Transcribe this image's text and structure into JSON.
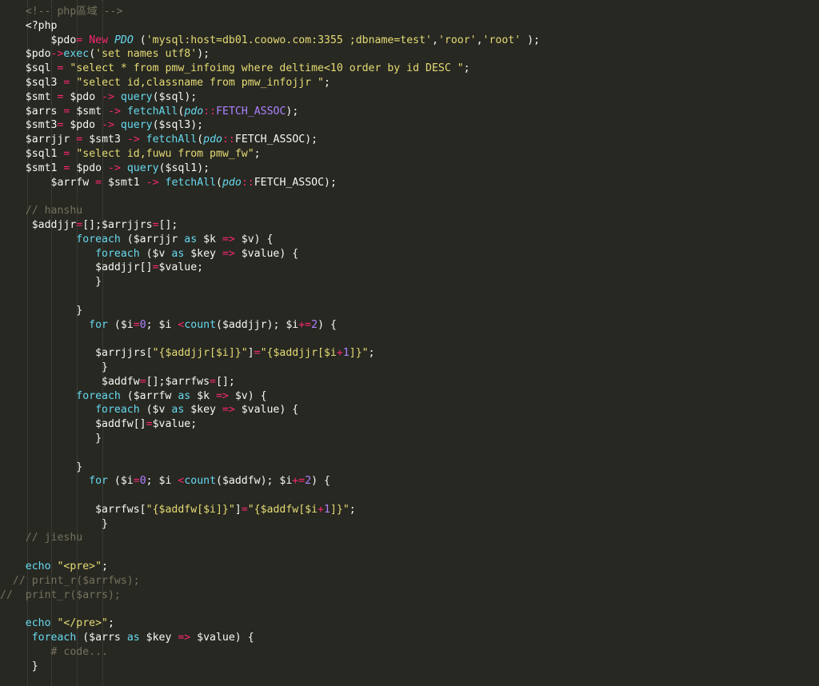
{
  "editor": {
    "theme_colors": {
      "background": "#272822",
      "text": "#f8f8f2",
      "keyword": "#66d9ef",
      "operator": "#f92672",
      "string": "#e6db74",
      "comment": "#75715e",
      "constant": "#ae81ff"
    },
    "lines": [
      {
        "indent": "    ",
        "tokens": [
          {
            "t": "cmt",
            "v": "<!-- php區域 -->"
          }
        ]
      },
      {
        "indent": "    ",
        "tokens": [
          {
            "t": "text",
            "v": "<?php"
          }
        ]
      },
      {
        "indent": "        ",
        "tokens": [
          {
            "t": "var",
            "v": "$pdo"
          },
          {
            "t": "op",
            "v": "="
          },
          {
            "t": "text",
            "v": " "
          },
          {
            "t": "kwr",
            "v": "New"
          },
          {
            "t": "text",
            "v": " "
          },
          {
            "t": "cls",
            "v": "PDO"
          },
          {
            "t": "text",
            "v": " ("
          },
          {
            "t": "str",
            "v": "'mysql:host=db01.coowo.com:3355 ;dbname=test'"
          },
          {
            "t": "text",
            "v": ","
          },
          {
            "t": "str",
            "v": "'roor'"
          },
          {
            "t": "text",
            "v": ","
          },
          {
            "t": "str",
            "v": "'root'"
          },
          {
            "t": "text",
            "v": " );"
          }
        ]
      },
      {
        "indent": "    ",
        "tokens": [
          {
            "t": "var",
            "v": "$pdo"
          },
          {
            "t": "op",
            "v": "->"
          },
          {
            "t": "fn",
            "v": "exec"
          },
          {
            "t": "text",
            "v": "("
          },
          {
            "t": "str",
            "v": "'set names utf8'"
          },
          {
            "t": "text",
            "v": ");"
          }
        ]
      },
      {
        "indent": "    ",
        "tokens": [
          {
            "t": "var",
            "v": "$sql"
          },
          {
            "t": "text",
            "v": " "
          },
          {
            "t": "op",
            "v": "="
          },
          {
            "t": "text",
            "v": " "
          },
          {
            "t": "str",
            "v": "\"select * from pmw_infoimg where deltime<10 order by id DESC \""
          },
          {
            "t": "text",
            "v": ";"
          }
        ]
      },
      {
        "indent": "    ",
        "tokens": [
          {
            "t": "var",
            "v": "$sql3"
          },
          {
            "t": "text",
            "v": " "
          },
          {
            "t": "op",
            "v": "="
          },
          {
            "t": "text",
            "v": " "
          },
          {
            "t": "str",
            "v": "\"select id,classname from pmw_infojjr \""
          },
          {
            "t": "text",
            "v": ";"
          }
        ]
      },
      {
        "indent": "    ",
        "tokens": [
          {
            "t": "var",
            "v": "$smt"
          },
          {
            "t": "text",
            "v": " "
          },
          {
            "t": "op",
            "v": "="
          },
          {
            "t": "text",
            "v": " $pdo "
          },
          {
            "t": "op",
            "v": "->"
          },
          {
            "t": "text",
            "v": " "
          },
          {
            "t": "fn",
            "v": "query"
          },
          {
            "t": "text",
            "v": "($sql);"
          }
        ]
      },
      {
        "indent": "    ",
        "tokens": [
          {
            "t": "var",
            "v": "$arrs"
          },
          {
            "t": "text",
            "v": " "
          },
          {
            "t": "op",
            "v": "="
          },
          {
            "t": "text",
            "v": " $smt "
          },
          {
            "t": "op",
            "v": "->"
          },
          {
            "t": "text",
            "v": " "
          },
          {
            "t": "fn",
            "v": "fetchAll"
          },
          {
            "t": "text",
            "v": "("
          },
          {
            "t": "cls",
            "v": "pdo"
          },
          {
            "t": "op",
            "v": "::"
          },
          {
            "t": "const",
            "v": "FETCH_ASSOC"
          },
          {
            "t": "text",
            "v": ");"
          }
        ]
      },
      {
        "indent": "    ",
        "tokens": [
          {
            "t": "var",
            "v": "$smt3"
          },
          {
            "t": "op",
            "v": "="
          },
          {
            "t": "text",
            "v": " $pdo "
          },
          {
            "t": "op",
            "v": "->"
          },
          {
            "t": "text",
            "v": " "
          },
          {
            "t": "fn",
            "v": "query"
          },
          {
            "t": "text",
            "v": "($sql3);"
          }
        ]
      },
      {
        "indent": "    ",
        "tokens": [
          {
            "t": "var",
            "v": "$arrjjr"
          },
          {
            "t": "text",
            "v": " "
          },
          {
            "t": "op",
            "v": "="
          },
          {
            "t": "text",
            "v": " $smt3 "
          },
          {
            "t": "op",
            "v": "->"
          },
          {
            "t": "text",
            "v": " "
          },
          {
            "t": "fn",
            "v": "fetchAll"
          },
          {
            "t": "text",
            "v": "("
          },
          {
            "t": "cls",
            "v": "pdo"
          },
          {
            "t": "op",
            "v": "::"
          },
          {
            "t": "text",
            "v": "FETCH_ASSOC);"
          }
        ]
      },
      {
        "indent": "    ",
        "tokens": [
          {
            "t": "var",
            "v": "$sql1"
          },
          {
            "t": "text",
            "v": " "
          },
          {
            "t": "op",
            "v": "="
          },
          {
            "t": "text",
            "v": " "
          },
          {
            "t": "str",
            "v": "\"select id,fuwu from pmw_fw\""
          },
          {
            "t": "text",
            "v": ";"
          }
        ]
      },
      {
        "indent": "    ",
        "tokens": [
          {
            "t": "var",
            "v": "$smt1"
          },
          {
            "t": "text",
            "v": " "
          },
          {
            "t": "op",
            "v": "="
          },
          {
            "t": "text",
            "v": " $pdo "
          },
          {
            "t": "op",
            "v": "->"
          },
          {
            "t": "text",
            "v": " "
          },
          {
            "t": "fn",
            "v": "query"
          },
          {
            "t": "text",
            "v": "($sql1);"
          }
        ]
      },
      {
        "indent": "        ",
        "tokens": [
          {
            "t": "var",
            "v": "$arrfw"
          },
          {
            "t": "text",
            "v": " "
          },
          {
            "t": "op",
            "v": "="
          },
          {
            "t": "text",
            "v": " $smt1 "
          },
          {
            "t": "op",
            "v": "->"
          },
          {
            "t": "text",
            "v": " "
          },
          {
            "t": "fn",
            "v": "fetchAll"
          },
          {
            "t": "text",
            "v": "("
          },
          {
            "t": "cls",
            "v": "pdo"
          },
          {
            "t": "op",
            "v": "::"
          },
          {
            "t": "text",
            "v": "FETCH_ASSOC);"
          }
        ]
      },
      {
        "indent": "",
        "tokens": []
      },
      {
        "indent": "    ",
        "tokens": [
          {
            "t": "cmt",
            "v": "// hanshu"
          }
        ]
      },
      {
        "indent": "     ",
        "tokens": [
          {
            "t": "var",
            "v": "$addjjr"
          },
          {
            "t": "op",
            "v": "="
          },
          {
            "t": "text",
            "v": "[];$arrjjrs"
          },
          {
            "t": "op",
            "v": "="
          },
          {
            "t": "text",
            "v": "[];"
          }
        ]
      },
      {
        "indent": "            ",
        "tokens": [
          {
            "t": "kw",
            "v": "foreach"
          },
          {
            "t": "text",
            "v": " ($arrjjr "
          },
          {
            "t": "kw",
            "v": "as"
          },
          {
            "t": "text",
            "v": " $k "
          },
          {
            "t": "op",
            "v": "=>"
          },
          {
            "t": "text",
            "v": " $v) {"
          }
        ]
      },
      {
        "indent": "               ",
        "tokens": [
          {
            "t": "kw",
            "v": "foreach"
          },
          {
            "t": "text",
            "v": " ($v "
          },
          {
            "t": "kw",
            "v": "as"
          },
          {
            "t": "text",
            "v": " $key "
          },
          {
            "t": "op",
            "v": "=>"
          },
          {
            "t": "text",
            "v": " $value) {"
          }
        ]
      },
      {
        "indent": "               ",
        "tokens": [
          {
            "t": "var",
            "v": "$addjjr"
          },
          {
            "t": "text",
            "v": "[]"
          },
          {
            "t": "op",
            "v": "="
          },
          {
            "t": "text",
            "v": "$value;"
          }
        ]
      },
      {
        "indent": "               ",
        "tokens": [
          {
            "t": "text",
            "v": "}"
          }
        ]
      },
      {
        "indent": "",
        "tokens": []
      },
      {
        "indent": "            ",
        "tokens": [
          {
            "t": "text",
            "v": "}"
          }
        ]
      },
      {
        "indent": "              ",
        "tokens": [
          {
            "t": "kw",
            "v": "for"
          },
          {
            "t": "text",
            "v": " ($i"
          },
          {
            "t": "op",
            "v": "="
          },
          {
            "t": "num",
            "v": "0"
          },
          {
            "t": "text",
            "v": "; $i "
          },
          {
            "t": "op",
            "v": "<"
          },
          {
            "t": "fn",
            "v": "count"
          },
          {
            "t": "text",
            "v": "($addjjr); $i"
          },
          {
            "t": "op",
            "v": "+="
          },
          {
            "t": "num",
            "v": "2"
          },
          {
            "t": "text",
            "v": ") {"
          }
        ]
      },
      {
        "indent": "",
        "tokens": []
      },
      {
        "indent": "               ",
        "tokens": [
          {
            "t": "var",
            "v": "$arrjjrs"
          },
          {
            "t": "text",
            "v": "["
          },
          {
            "t": "str",
            "v": "\"{$addjjr[$i]}\""
          },
          {
            "t": "text",
            "v": "]"
          },
          {
            "t": "op",
            "v": "="
          },
          {
            "t": "str",
            "v": "\"{$addjjr[$i"
          },
          {
            "t": "op",
            "v": "+"
          },
          {
            "t": "num",
            "v": "1"
          },
          {
            "t": "str",
            "v": "]}\""
          },
          {
            "t": "text",
            "v": ";"
          }
        ]
      },
      {
        "indent": "                ",
        "tokens": [
          {
            "t": "text",
            "v": "}"
          }
        ]
      },
      {
        "indent": "                ",
        "tokens": [
          {
            "t": "var",
            "v": "$addfw"
          },
          {
            "t": "op",
            "v": "="
          },
          {
            "t": "text",
            "v": "[];$arrfws"
          },
          {
            "t": "op",
            "v": "="
          },
          {
            "t": "text",
            "v": "[];"
          }
        ]
      },
      {
        "indent": "            ",
        "tokens": [
          {
            "t": "kw",
            "v": "foreach"
          },
          {
            "t": "text",
            "v": " ($arrfw "
          },
          {
            "t": "kw",
            "v": "as"
          },
          {
            "t": "text",
            "v": " $k "
          },
          {
            "t": "op",
            "v": "=>"
          },
          {
            "t": "text",
            "v": " $v) {"
          }
        ]
      },
      {
        "indent": "               ",
        "tokens": [
          {
            "t": "kw",
            "v": "foreach"
          },
          {
            "t": "text",
            "v": " ($v "
          },
          {
            "t": "kw",
            "v": "as"
          },
          {
            "t": "text",
            "v": " $key "
          },
          {
            "t": "op",
            "v": "=>"
          },
          {
            "t": "text",
            "v": " $value) {"
          }
        ]
      },
      {
        "indent": "               ",
        "tokens": [
          {
            "t": "var",
            "v": "$addfw"
          },
          {
            "t": "text",
            "v": "[]"
          },
          {
            "t": "op",
            "v": "="
          },
          {
            "t": "text",
            "v": "$value;"
          }
        ]
      },
      {
        "indent": "               ",
        "tokens": [
          {
            "t": "text",
            "v": "}"
          }
        ]
      },
      {
        "indent": "",
        "tokens": []
      },
      {
        "indent": "            ",
        "tokens": [
          {
            "t": "text",
            "v": "}"
          }
        ]
      },
      {
        "indent": "              ",
        "tokens": [
          {
            "t": "kw",
            "v": "for"
          },
          {
            "t": "text",
            "v": " ($i"
          },
          {
            "t": "op",
            "v": "="
          },
          {
            "t": "num",
            "v": "0"
          },
          {
            "t": "text",
            "v": "; $i "
          },
          {
            "t": "op",
            "v": "<"
          },
          {
            "t": "fn",
            "v": "count"
          },
          {
            "t": "text",
            "v": "($addfw); $i"
          },
          {
            "t": "op",
            "v": "+="
          },
          {
            "t": "num",
            "v": "2"
          },
          {
            "t": "text",
            "v": ") {"
          }
        ]
      },
      {
        "indent": "",
        "tokens": []
      },
      {
        "indent": "               ",
        "tokens": [
          {
            "t": "var",
            "v": "$arrfws"
          },
          {
            "t": "text",
            "v": "["
          },
          {
            "t": "str",
            "v": "\"{$addfw[$i]}\""
          },
          {
            "t": "text",
            "v": "]"
          },
          {
            "t": "op",
            "v": "="
          },
          {
            "t": "str",
            "v": "\"{$addfw[$i"
          },
          {
            "t": "op",
            "v": "+"
          },
          {
            "t": "num",
            "v": "1"
          },
          {
            "t": "str",
            "v": "]}\""
          },
          {
            "t": "text",
            "v": ";"
          }
        ]
      },
      {
        "indent": "                ",
        "tokens": [
          {
            "t": "text",
            "v": "}"
          }
        ]
      },
      {
        "indent": "    ",
        "tokens": [
          {
            "t": "cmt",
            "v": "// jieshu"
          }
        ]
      },
      {
        "indent": "",
        "tokens": []
      },
      {
        "indent": "    ",
        "tokens": [
          {
            "t": "kw",
            "v": "echo"
          },
          {
            "t": "text",
            "v": " "
          },
          {
            "t": "str",
            "v": "\"<pre>\""
          },
          {
            "t": "text",
            "v": ";"
          }
        ]
      },
      {
        "indent": "  ",
        "tokens": [
          {
            "t": "cmt",
            "v": "// print_r($arrfws);"
          }
        ]
      },
      {
        "indent": "",
        "tokens": [
          {
            "t": "cmt",
            "v": "//  print_r($arrs);"
          }
        ]
      },
      {
        "indent": "",
        "tokens": []
      },
      {
        "indent": "    ",
        "tokens": [
          {
            "t": "kw",
            "v": "echo"
          },
          {
            "t": "text",
            "v": " "
          },
          {
            "t": "str",
            "v": "\"</pre>\""
          },
          {
            "t": "text",
            "v": ";"
          }
        ]
      },
      {
        "indent": "     ",
        "tokens": [
          {
            "t": "kw",
            "v": "foreach"
          },
          {
            "t": "text",
            "v": " ($arrs "
          },
          {
            "t": "kw",
            "v": "as"
          },
          {
            "t": "text",
            "v": " $key "
          },
          {
            "t": "op",
            "v": "=>"
          },
          {
            "t": "text",
            "v": " $value) {"
          }
        ]
      },
      {
        "indent": "        ",
        "tokens": [
          {
            "t": "cmt",
            "v": "# code..."
          }
        ]
      },
      {
        "indent": "     ",
        "tokens": [
          {
            "t": "text",
            "v": "}"
          }
        ]
      }
    ]
  }
}
